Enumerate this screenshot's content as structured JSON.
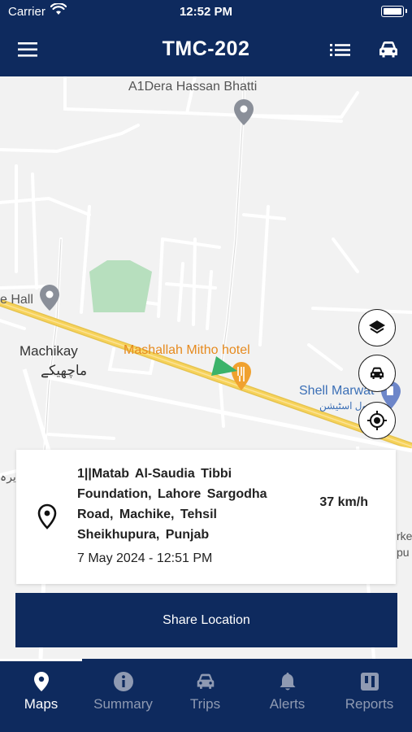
{
  "status": {
    "carrier": "Carrier",
    "time": "12:52 PM"
  },
  "appbar": {
    "title": "TMC-202"
  },
  "map": {
    "labels": {
      "dera": "A1Dera Hassan Bhatti",
      "hall": "e Hall",
      "machikay": "Machikay",
      "machikay_urdu": "ماچھیکے",
      "hotel": "Mashallah Mitho hotel",
      "shell": "Shell Marwat",
      "shell_urdu": "پیٹرول اسٹیشن",
      "edge_left": "یرہ",
      "edge_right1": "rke",
      "edge_right2": "pu"
    }
  },
  "card": {
    "address": "1||Matab Al-Saudia Tibbi Foundation, Lahore Sargodha Road, Machike, Tehsil Sheikhupura, Punjab",
    "datetime": "7 May 2024 - 12:51 PM",
    "speed": "37 km/h"
  },
  "share_label": "Share Location",
  "tabs": [
    {
      "label": "Maps",
      "icon": "map-pin-icon",
      "active": true
    },
    {
      "label": "Summary",
      "icon": "info-icon",
      "active": false
    },
    {
      "label": "Trips",
      "icon": "car-icon",
      "active": false
    },
    {
      "label": "Alerts",
      "icon": "bell-icon",
      "active": false
    },
    {
      "label": "Reports",
      "icon": "report-icon",
      "active": false
    }
  ],
  "colors": {
    "primary": "#0e2a5e",
    "road_highlight": "#f5c842",
    "vehicle_marker": "#3bb36a",
    "poi_orange": "#e68a1e"
  }
}
